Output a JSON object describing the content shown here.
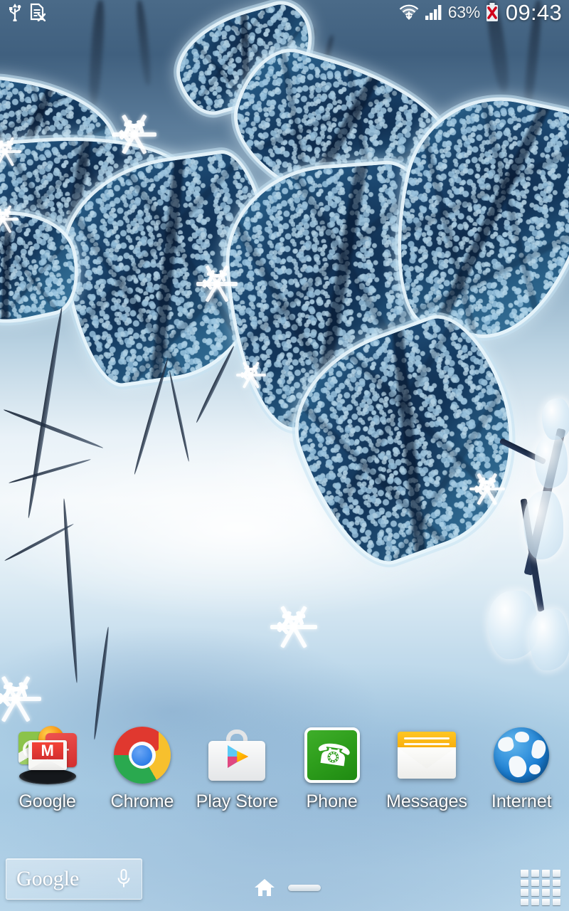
{
  "status_bar": {
    "left_icons": [
      {
        "name": "usb-icon",
        "label": "USB connected"
      },
      {
        "name": "no-sim-icon",
        "label": "No SIM card"
      }
    ],
    "right_icons": [
      {
        "name": "wifi-icon",
        "label": "Wi-Fi connected"
      },
      {
        "name": "signal-icon",
        "label": "Mobile signal"
      },
      {
        "name": "battery-icon",
        "label": "Battery not charging"
      }
    ],
    "battery_percent": "63%",
    "clock": "09:43"
  },
  "home_screen": {
    "apps": [
      {
        "label": "Google",
        "icon": "google-folder-icon"
      },
      {
        "label": "Chrome",
        "icon": "chrome-icon"
      },
      {
        "label": "Play Store",
        "icon": "play-store-icon"
      },
      {
        "label": "Phone",
        "icon": "phone-icon"
      },
      {
        "label": "Messages",
        "icon": "messages-icon"
      },
      {
        "label": "Internet",
        "icon": "internet-globe-icon"
      }
    ]
  },
  "search_widget": {
    "text": "Google",
    "mic_icon": "microphone-icon"
  },
  "nav_bar": {
    "home_icon": "home-icon",
    "recents_icon": "recent-apps-icon",
    "app_drawer_icon": "app-drawer-grid-icon"
  },
  "wallpaper": {
    "description": "Frost-covered blue leaves over a snowy path with snowflake overlays",
    "accent_leaf": "#1d4a73",
    "accent_frost": "#e9f6fc",
    "accent_snow": "#bcd9ec"
  }
}
